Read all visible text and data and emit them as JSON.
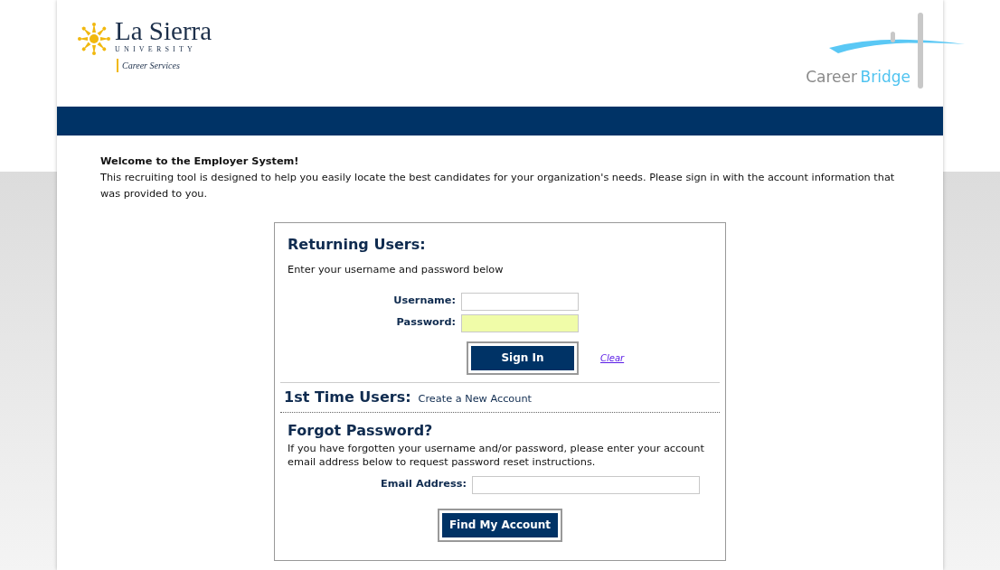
{
  "header": {
    "logo": {
      "name": "La Sierra",
      "subname": "UNIVERSITY",
      "tagline": "Career Services"
    },
    "brand": {
      "word_1": "Career",
      "word_2": "Bridge"
    }
  },
  "intro": {
    "title": "Welcome to the Employer System!",
    "text": "This recruiting tool is designed to help you easily locate the best candidates for your organization's needs. Please sign in with the account information that was provided to you."
  },
  "login": {
    "title": "Returning Users:",
    "instruction": "Enter your username and password below",
    "fields": [
      {
        "label": "Username:",
        "highlighted": false
      },
      {
        "label": "Password:",
        "highlighted": true
      }
    ],
    "submit": "Sign In",
    "clear": "Clear"
  },
  "first_time": {
    "title": "1st Time Users:",
    "link": "Create a New Account"
  },
  "forgot": {
    "title": "Forgot Password?",
    "text": "If you have forgotten your username and/or password, please enter your account email address below to request password reset instructions.",
    "field_label": "Email Address:",
    "submit": "Find My Account"
  }
}
